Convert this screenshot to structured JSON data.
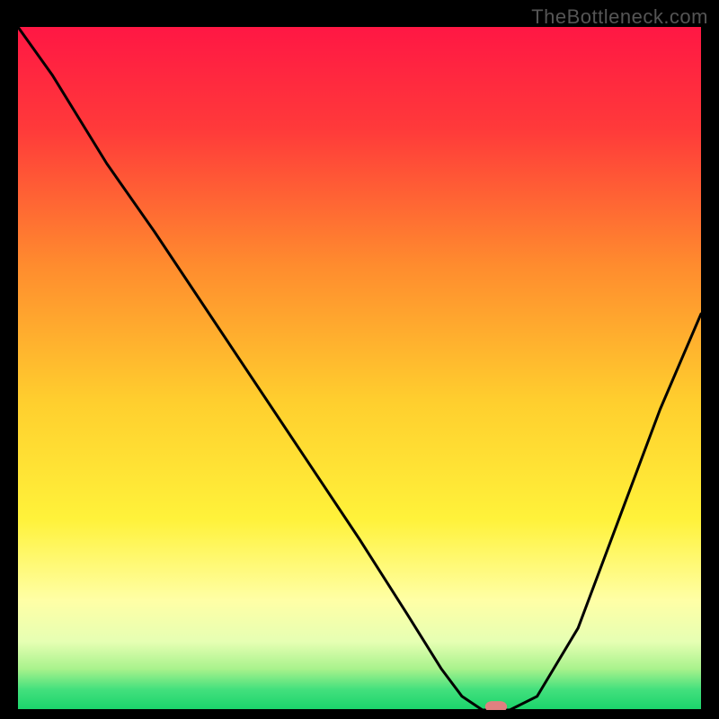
{
  "watermark": "TheBottleneck.com",
  "chart_data": {
    "type": "line",
    "title": "",
    "xlabel": "",
    "ylabel": "",
    "xlim": [
      0,
      100
    ],
    "ylim": [
      0,
      100
    ],
    "grid": false,
    "legend": false,
    "gradient_stops": [
      {
        "offset": 0.0,
        "color": "#ff1744"
      },
      {
        "offset": 0.15,
        "color": "#ff3a3a"
      },
      {
        "offset": 0.35,
        "color": "#ff8c2e"
      },
      {
        "offset": 0.55,
        "color": "#ffcf2e"
      },
      {
        "offset": 0.72,
        "color": "#fff23a"
      },
      {
        "offset": 0.84,
        "color": "#ffffa6"
      },
      {
        "offset": 0.9,
        "color": "#e6ffb3"
      },
      {
        "offset": 0.94,
        "color": "#a8f28c"
      },
      {
        "offset": 0.97,
        "color": "#43e07d"
      },
      {
        "offset": 1.0,
        "color": "#19d46b"
      }
    ],
    "series": [
      {
        "name": "bottleneck-curve",
        "color": "#000000",
        "x": [
          0,
          5,
          13,
          20,
          30,
          40,
          50,
          57,
          62,
          65,
          68,
          72,
          76,
          82,
          88,
          94,
          100
        ],
        "y": [
          100,
          93,
          80,
          70,
          55,
          40,
          25,
          14,
          6,
          2,
          0,
          0,
          2,
          12,
          28,
          44,
          58
        ]
      }
    ],
    "marker": {
      "x": 70,
      "y": 0.5,
      "width": 3.2,
      "height": 1.6,
      "rx": 1.0,
      "color": "#e08080"
    },
    "baseline": {
      "y": 0,
      "color": "#000000",
      "width": 2
    }
  }
}
